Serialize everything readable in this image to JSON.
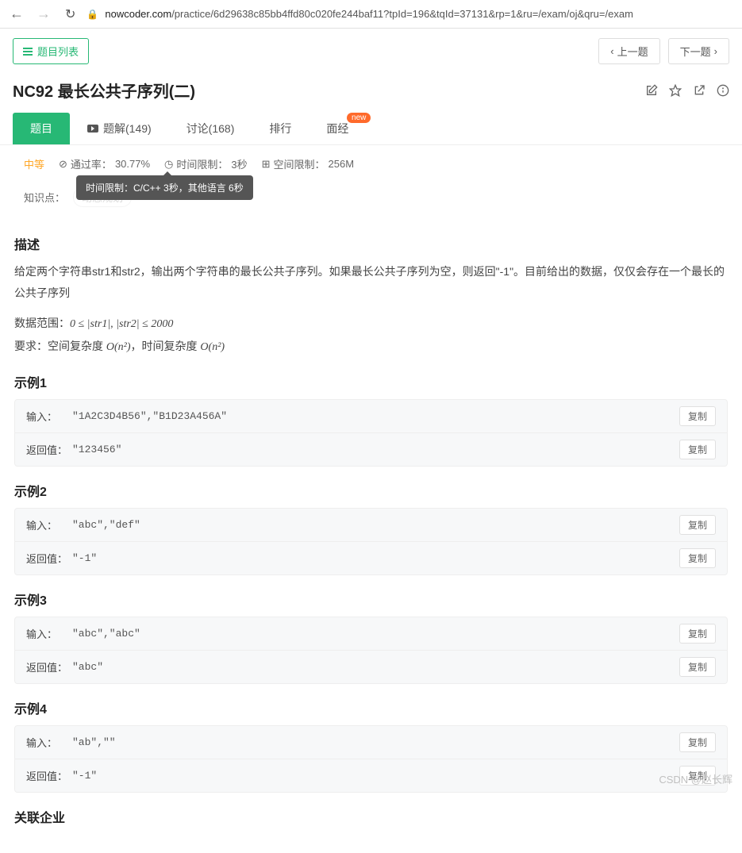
{
  "browser": {
    "url_domain": "nowcoder.com",
    "url_path": "/practice/6d29638c85bb4ffd80c020fe244baf11?tpId=196&tqId=37131&rp=1&ru=/exam/oj&qru=/exam"
  },
  "topbar": {
    "list_button": "题目列表",
    "prev_button": "上一题",
    "next_button": "下一题"
  },
  "title": "NC92  最长公共子序列(二)",
  "tabs": {
    "problem": "题目",
    "solutions": "题解(149)",
    "discuss": "讨论(168)",
    "rank": "排行",
    "interview": "面经",
    "new_badge": "new"
  },
  "meta": {
    "difficulty": "中等",
    "pass_rate_label": "通过率：",
    "pass_rate_value": "30.77%",
    "time_limit_label": "时间限制：",
    "time_limit_value": "3秒",
    "space_limit_label": "空间限制：",
    "space_limit_value": "256M",
    "tooltip": "时间限制：C/C++ 3秒，其他语言 6秒"
  },
  "knowledge": {
    "label": "知识点：",
    "tag": "动态规划"
  },
  "sections": {
    "desc_h": "描述",
    "desc_p": "给定两个字符串str1和str2，输出两个字符串的最长公共子序列。如果最长公共子序列为空，则返回\"-1\"。目前给出的数据，仅仅会存在一个最长的公共子序列",
    "range_prefix": "数据范围：",
    "range_math": "0 ≤ |str1|, |str2| ≤ 2000",
    "req_prefix": "要求：空间复杂度 ",
    "req_mid": "，时间复杂度 ",
    "on2": "O(n²)",
    "ex1_h": "示例1",
    "ex2_h": "示例2",
    "ex3_h": "示例3",
    "ex4_h": "示例4",
    "related_h": "关联企业"
  },
  "labels": {
    "input": "输入：",
    "output": "返回值：",
    "copy": "复制"
  },
  "examples": [
    {
      "input": "\"1A2C3D4B56\",\"B1D23A456A\"",
      "output": "\"123456\""
    },
    {
      "input": "\"abc\",\"def\"",
      "output": "\"-1\""
    },
    {
      "input": "\"abc\",\"abc\"",
      "output": "\"abc\""
    },
    {
      "input": "\"ab\",\"\"",
      "output": "\"-1\""
    }
  ],
  "watermark": "CSDN @赵长辉"
}
